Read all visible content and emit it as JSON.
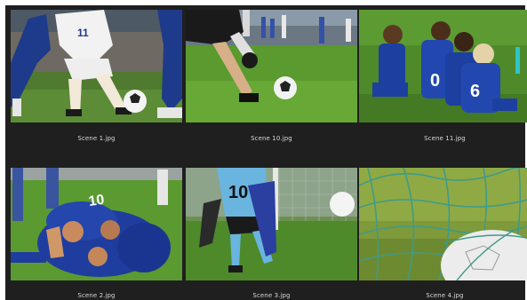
{
  "gallery": {
    "items": [
      {
        "filename": "Scene 1.jpg",
        "jersey": "11"
      },
      {
        "filename": "Scene 10.jpg"
      },
      {
        "filename": "Scene 11.jpg",
        "jerseys": [
          "0",
          "6"
        ]
      },
      {
        "filename": "Scene 2.jpg",
        "jersey": "10"
      },
      {
        "filename": "Scene 3.jpg",
        "jersey": "10"
      },
      {
        "filename": "Scene 4.jpg"
      }
    ]
  }
}
